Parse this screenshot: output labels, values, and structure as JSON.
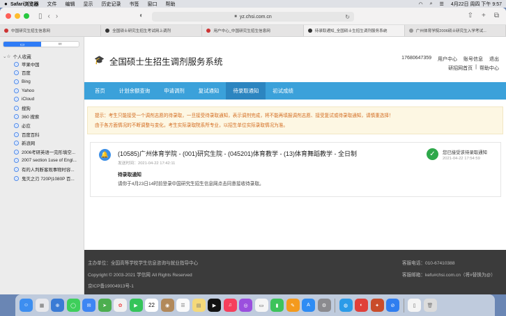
{
  "menubar": {
    "apple": "",
    "items": [
      "Safari浏览器",
      "文件",
      "编辑",
      "显示",
      "历史记录",
      "书签",
      "窗口",
      "帮助"
    ],
    "clock": "4月22日 周四 下午 9:57"
  },
  "browser": {
    "url": "yz.chsi.com.cn",
    "tabs": [
      "中国研究生招生信息网",
      "全国硕士研究生招生考试网上调剂",
      "用户中心_中国研究生招生信息网",
      "待录取通知_全国硕士生招生调剂服务系统",
      "广州体育学院2006硕士研究生入学考试..."
    ],
    "active_tab": 3
  },
  "sidebar": {
    "header": "个人收藏",
    "items": [
      "苹果中国",
      "百度",
      "Bing",
      "Yahoo",
      "iCloud",
      "搜狗",
      "360 搜索",
      "必应",
      "百度百科",
      "新浪网",
      "2006考研英语一完形填空...",
      "2007 section 1use of Engl...",
      "有的人判断客观事物时容...",
      "鬼灭之刃 720P|1080P 百..."
    ]
  },
  "header": {
    "title": "全国硕士生招生调剂服务系统",
    "phone": "17680647359",
    "links": [
      "用户中心",
      "账号信息",
      "退出"
    ],
    "links2": [
      "研招网首页",
      "|",
      "帮助中心"
    ]
  },
  "nav": {
    "items": [
      "首页",
      "计划余额查询",
      "申请调剂",
      "复试通知",
      "待录取通知",
      "初试成绩"
    ],
    "active": 4
  },
  "notice": {
    "line1": "提示：考生只能接受一个调剂志愿的待录取，一旦接受待录取通知，表示调剂完成，将不能再填报调剂志愿、接受复试或待录取通知，请慎重选择！",
    "line2": "由于各方面情况的不断调整与变化，考生实际录取院系所专业，以招生单位实际录取情况为准。"
  },
  "card": {
    "title": "(10585)广州体育学院 - (001)研究生院 - (045201)体育教学 - (13)体育舞蹈教学 - 全日制",
    "send_time": "发送时间：2021-04-22 17:42:11",
    "label": "待录取通知",
    "message": "请你于4月23日14时前登录中国研究生招生信息网点击同意接收待录取。",
    "status": "您已接受该待录取通知",
    "accept_time": "2021-04-22 17:54:59"
  },
  "footer": {
    "sponsor": "主办单位：全国高等学校学生信息咨询与就业指导中心",
    "copyright": "Copyright © 2003-2021 学信网 All Rights Reserved",
    "icp": "京ICP备19004913号-1",
    "hotline": "客服电话：010-67410388",
    "email": "客服邮箱：kefu#chsi.com.cn（将#替换为@）"
  },
  "dock": {
    "calendar_day": "22"
  },
  "colors": {
    "nav": "#3ba1da",
    "nav_active": "#2c85c0",
    "notice_text": "#d26a1d",
    "footer": "#3b3b3b",
    "success": "#2ea84a"
  }
}
